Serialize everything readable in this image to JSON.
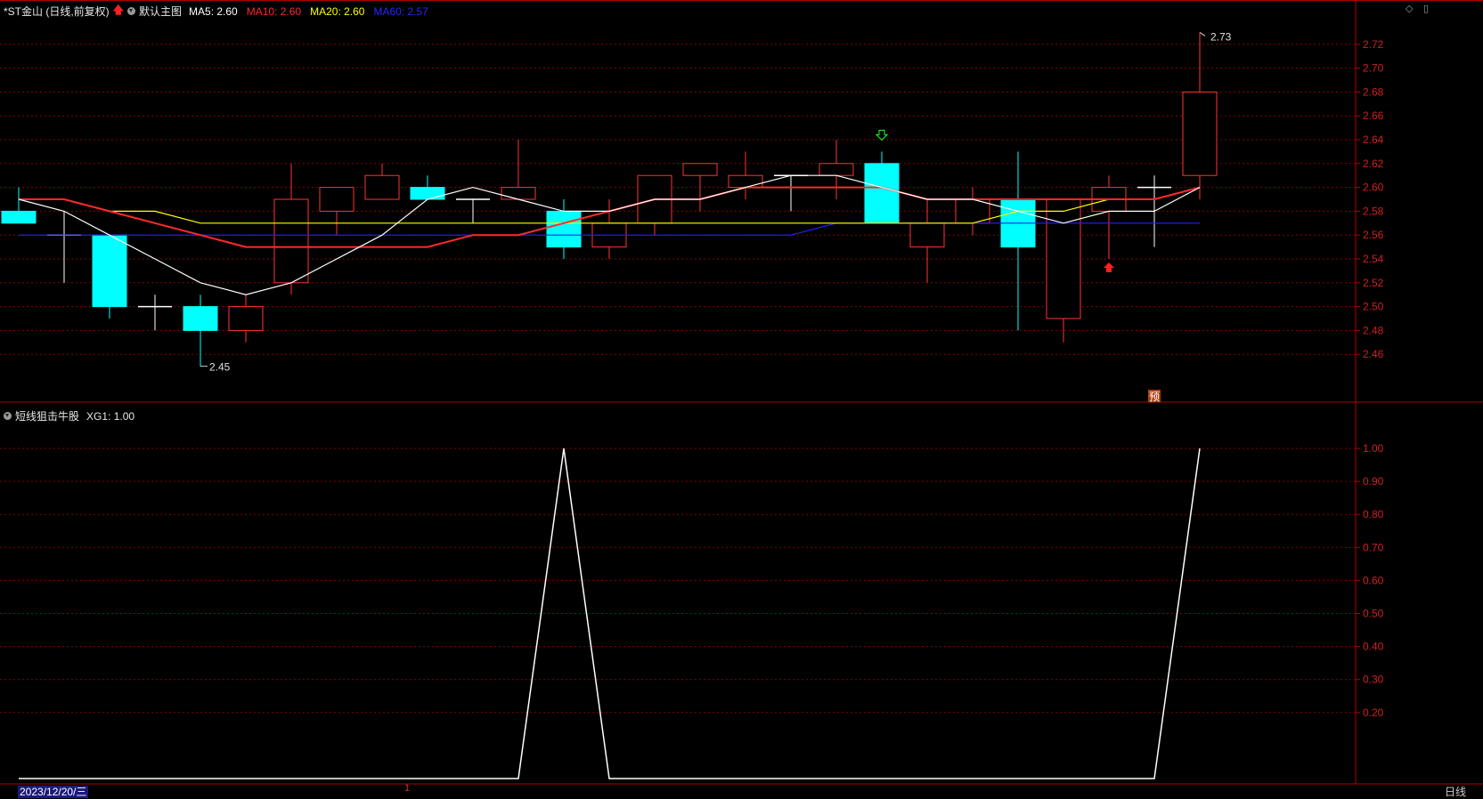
{
  "main": {
    "title": "*ST金山 (日线,前复权)",
    "template_name": "默认主图",
    "ma5": "MA5: 2.60",
    "ma10": "MA10: 2.60",
    "ma20": "MA20: 2.60",
    "ma60": "MA60: 2.57"
  },
  "sub": {
    "indicator": "短线狙击牛股",
    "value": "XG1: 1.00"
  },
  "footer": {
    "date": "2023/12/20/三",
    "timeframe": "日线",
    "cursor_tick": "1"
  },
  "annotations": {
    "high_label": "2.73",
    "low_label": "2.45",
    "pre_badge": "预"
  },
  "icons": [
    "up-arrow-icon",
    "collapse-circle-icon",
    "diamond-icon",
    "square-icon"
  ],
  "colors": {
    "up": "#ff3333",
    "down": "#00ffff",
    "ma5": "#ffffff",
    "ma10": "#ff2a2a",
    "ma20": "#ffff00",
    "ma60": "#2222ff",
    "grid": "#8b0000",
    "axis_text": "#d02020"
  },
  "chart_data": [
    {
      "type": "candlestick",
      "title": "*ST金山 (日线,前复权)",
      "y_ticks": [
        2.46,
        2.48,
        2.5,
        2.52,
        2.54,
        2.56,
        2.58,
        2.6,
        2.62,
        2.64,
        2.66,
        2.68,
        2.7,
        2.72
      ],
      "ylim": [
        2.44,
        2.74
      ],
      "ohlc": [
        [
          2.58,
          2.6,
          2.57,
          2.57
        ],
        [
          2.56,
          2.58,
          2.52,
          2.56
        ],
        [
          2.56,
          2.56,
          2.49,
          2.5
        ],
        [
          2.5,
          2.51,
          2.48,
          2.5
        ],
        [
          2.5,
          2.51,
          2.45,
          2.48
        ],
        [
          2.48,
          2.51,
          2.47,
          2.5
        ],
        [
          2.52,
          2.62,
          2.51,
          2.59
        ],
        [
          2.58,
          2.6,
          2.56,
          2.6
        ],
        [
          2.59,
          2.62,
          2.59,
          2.61
        ],
        [
          2.6,
          2.61,
          2.59,
          2.59
        ],
        [
          2.59,
          2.59,
          2.57,
          2.59
        ],
        [
          2.59,
          2.64,
          2.59,
          2.6
        ],
        [
          2.58,
          2.59,
          2.54,
          2.55
        ],
        [
          2.55,
          2.59,
          2.54,
          2.57
        ],
        [
          2.57,
          2.61,
          2.56,
          2.61
        ],
        [
          2.61,
          2.62,
          2.58,
          2.62
        ],
        [
          2.6,
          2.63,
          2.59,
          2.61
        ],
        [
          2.61,
          2.61,
          2.58,
          2.61
        ],
        [
          2.61,
          2.64,
          2.59,
          2.62
        ],
        [
          2.62,
          2.63,
          2.57,
          2.57
        ],
        [
          2.55,
          2.59,
          2.52,
          2.57
        ],
        [
          2.57,
          2.6,
          2.56,
          2.59
        ],
        [
          2.59,
          2.63,
          2.48,
          2.55
        ],
        [
          2.49,
          2.59,
          2.47,
          2.59
        ],
        [
          2.58,
          2.61,
          2.54,
          2.6
        ],
        [
          2.6,
          2.61,
          2.55,
          2.6
        ],
        [
          2.61,
          2.73,
          2.59,
          2.68
        ]
      ],
      "ma5": [
        2.59,
        2.58,
        2.56,
        2.54,
        2.52,
        2.51,
        2.52,
        2.54,
        2.56,
        2.59,
        2.6,
        2.59,
        2.58,
        2.58,
        2.59,
        2.59,
        2.6,
        2.61,
        2.61,
        2.6,
        2.59,
        2.59,
        2.58,
        2.57,
        2.58,
        2.58,
        2.6
      ],
      "ma10": [
        2.59,
        2.59,
        2.58,
        2.57,
        2.56,
        2.55,
        2.55,
        2.55,
        2.55,
        2.55,
        2.56,
        2.56,
        2.57,
        2.58,
        2.59,
        2.59,
        2.6,
        2.6,
        2.6,
        2.6,
        2.59,
        2.59,
        2.59,
        2.59,
        2.59,
        2.59,
        2.6
      ],
      "ma20": [
        2.59,
        2.59,
        2.58,
        2.58,
        2.57,
        2.57,
        2.57,
        2.57,
        2.57,
        2.57,
        2.57,
        2.57,
        2.57,
        2.57,
        2.57,
        2.57,
        2.57,
        2.57,
        2.57,
        2.57,
        2.57,
        2.57,
        2.58,
        2.58,
        2.59,
        2.59,
        2.6
      ],
      "ma60": [
        2.56,
        2.56,
        2.56,
        2.56,
        2.56,
        2.56,
        2.56,
        2.56,
        2.56,
        2.56,
        2.56,
        2.56,
        2.56,
        2.56,
        2.56,
        2.56,
        2.56,
        2.56,
        2.57,
        2.57,
        2.57,
        2.57,
        2.57,
        2.57,
        2.57,
        2.57,
        2.57
      ],
      "signals": {
        "down_arrow_index": 19,
        "up_arrow_index": 24,
        "pre_index": 25,
        "high_index": 26,
        "low_index": 4
      }
    },
    {
      "type": "line",
      "title": "短线狙击牛股",
      "series": [
        {
          "name": "XG1",
          "values": [
            0,
            0,
            0,
            0,
            0,
            0,
            0,
            0,
            0,
            0,
            0,
            0,
            1,
            0,
            0,
            0,
            0,
            0,
            0,
            0,
            0,
            0,
            0,
            0,
            0,
            0,
            1
          ]
        }
      ],
      "y_ticks": [
        0.2,
        0.3,
        0.4,
        0.5,
        0.6,
        0.7,
        0.8,
        0.9,
        1.0
      ],
      "ylim": [
        0,
        1.0
      ]
    }
  ]
}
